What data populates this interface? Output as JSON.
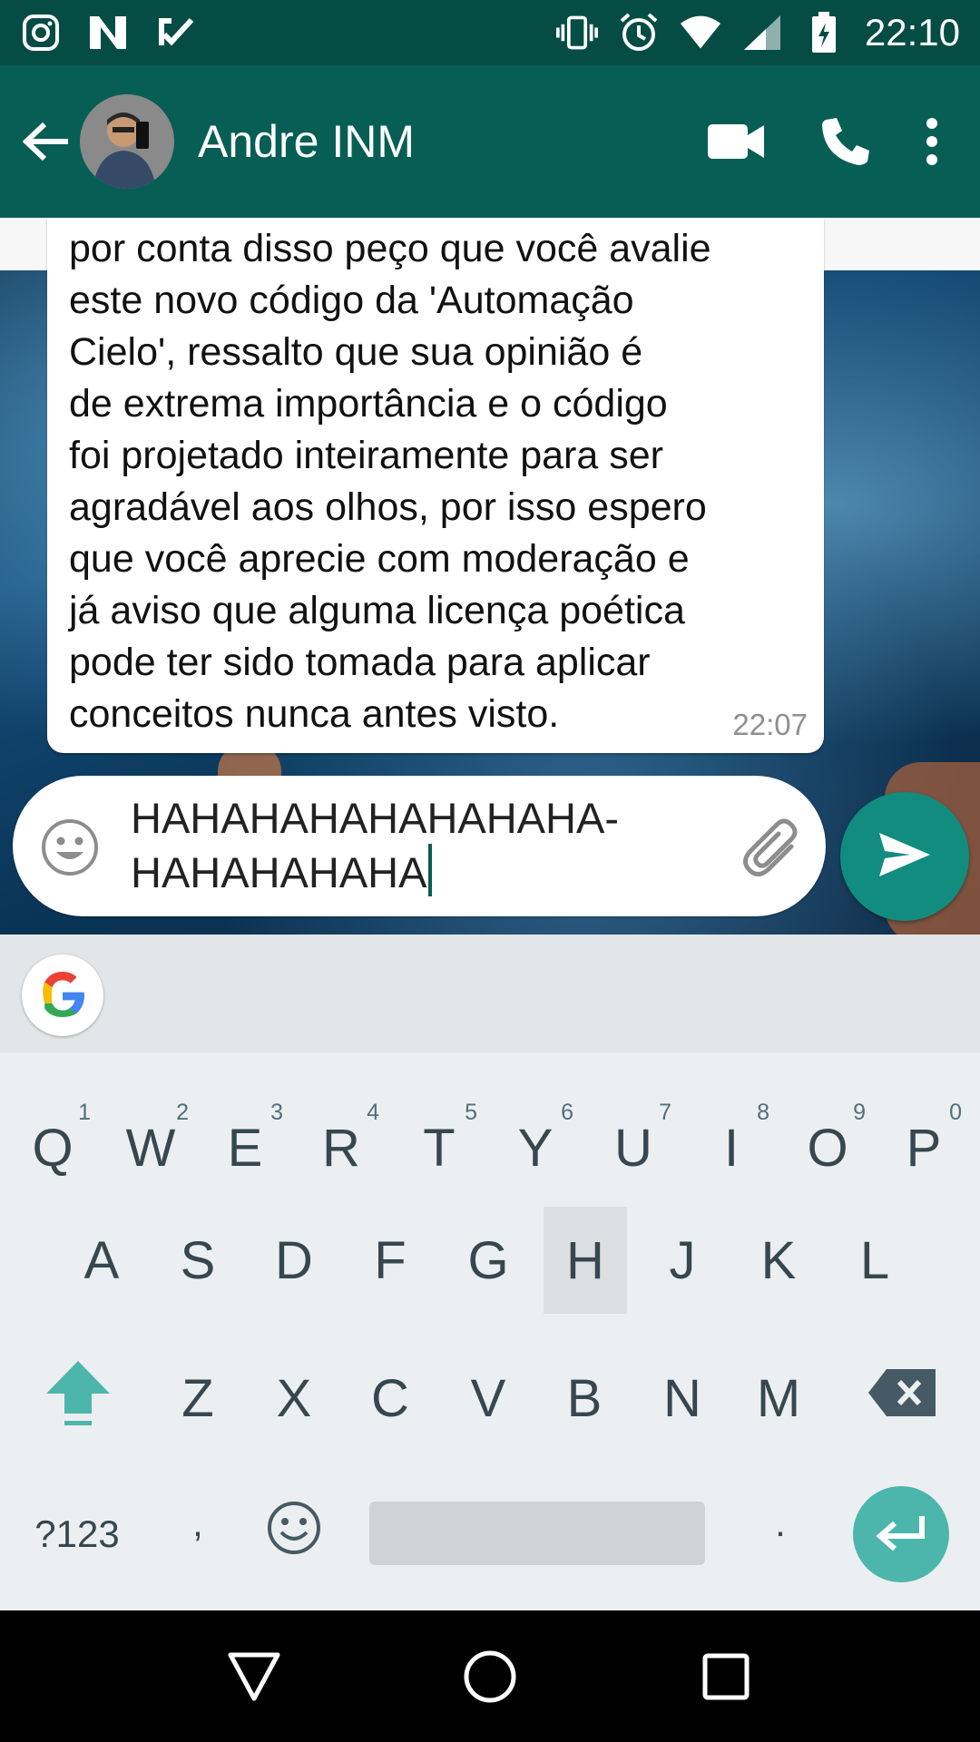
{
  "status_bar": {
    "time": "22:10",
    "left_icons": [
      "instagram-icon",
      "notification-n-icon",
      "task-check-icon"
    ],
    "right_icons": [
      "vibrate-icon",
      "alarm-icon",
      "wifi-icon",
      "signal-icon",
      "battery-charging-icon"
    ]
  },
  "header": {
    "contact_name": "Andre INM",
    "actions": [
      "video-call-icon",
      "phone-call-icon",
      "more-options-icon"
    ],
    "color": "#075e54"
  },
  "chat": {
    "messages": [
      {
        "text": "por conta disso peço que você avalie\neste novo código da 'Automação\nCielo', ressalto que sua opinião é\nde extrema importância e o código\nfoi projetado inteiramente para ser\nagradável aos olhos, por isso espero\nque você aprecie com moderação e\njá aviso que alguma licença poética\npode ter sido tomada para aplicar\nconceitos nunca antes visto.",
        "time": "22:07"
      }
    ]
  },
  "composer": {
    "value": "HAHAHAHAHAHAHAHA-\nHAHAHAHAHA",
    "send_color": "#128c7e"
  },
  "keyboard": {
    "row1": [
      {
        "key": "Q",
        "hint": "1"
      },
      {
        "key": "W",
        "hint": "2"
      },
      {
        "key": "E",
        "hint": "3"
      },
      {
        "key": "R",
        "hint": "4"
      },
      {
        "key": "T",
        "hint": "5"
      },
      {
        "key": "Y",
        "hint": "6"
      },
      {
        "key": "U",
        "hint": "7"
      },
      {
        "key": "I",
        "hint": "8"
      },
      {
        "key": "O",
        "hint": "9"
      },
      {
        "key": "P",
        "hint": "0"
      }
    ],
    "row2": [
      "A",
      "S",
      "D",
      "F",
      "G",
      "H",
      "J",
      "K",
      "L"
    ],
    "row3": [
      "Z",
      "X",
      "C",
      "V",
      "B",
      "N",
      "M"
    ],
    "pressed_key": "H",
    "symbols_label": "?123",
    "comma": ",",
    "period": ".",
    "accent": "#4db6ac"
  },
  "nav_bar": {
    "buttons": [
      "back-triangle-icon",
      "home-circle-icon",
      "recents-square-icon"
    ]
  }
}
